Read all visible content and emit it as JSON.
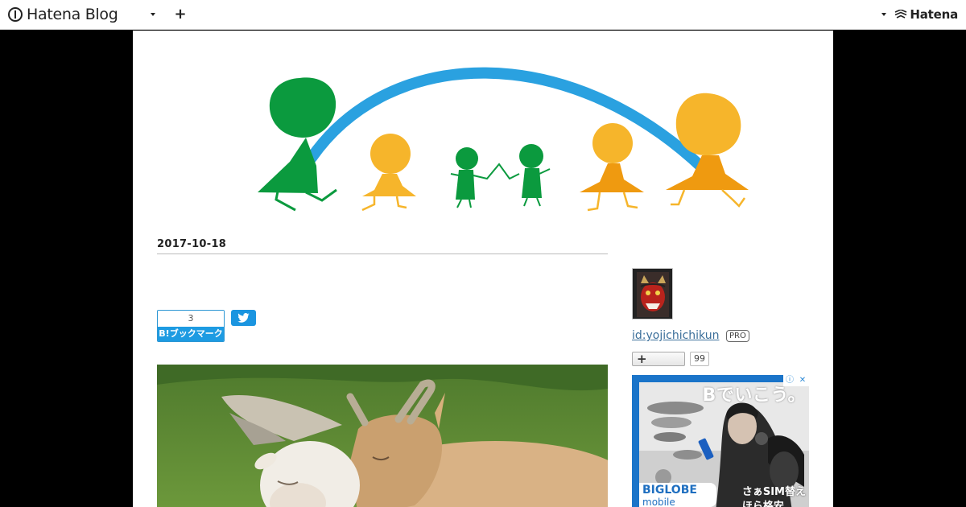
{
  "topbar": {
    "brand": "Hatena Blog",
    "add_label": "+",
    "account_logo": "Hatena",
    "icons": [
      "hatena-blog-icon",
      "chevron-down-icon",
      "plus-icon",
      "hatena-mark-icon"
    ]
  },
  "header_illustration": {
    "colors": {
      "arch": "#2aa1e0",
      "green": "#0b9a3e",
      "yellow": "#f6b52b",
      "orange": "#ef9a10"
    }
  },
  "entry": {
    "date": "2017-10-18",
    "bookmark_count": "3",
    "bookmark_label": "B!ブックマーク",
    "twitter_icon": "twitter-icon"
  },
  "sidebar": {
    "profile_id": "id:yojichichikun",
    "pro_label": "PRO",
    "follow_label": "+",
    "follow_count": "99"
  },
  "ad": {
    "headline": "Bでいこう。",
    "brand": "BIGLOBE",
    "brand_sub": "mobile",
    "copy_line1": "さぁSIM替え",
    "copy_line2": "ほら格安",
    "controls": [
      "ⓘ",
      "✕"
    ]
  },
  "colors": {
    "accent": "#1d9be2",
    "twitter": "#1b95e0",
    "link": "#3a6e9a",
    "page_bg": "#000000",
    "content_bg": "#ffffff"
  }
}
